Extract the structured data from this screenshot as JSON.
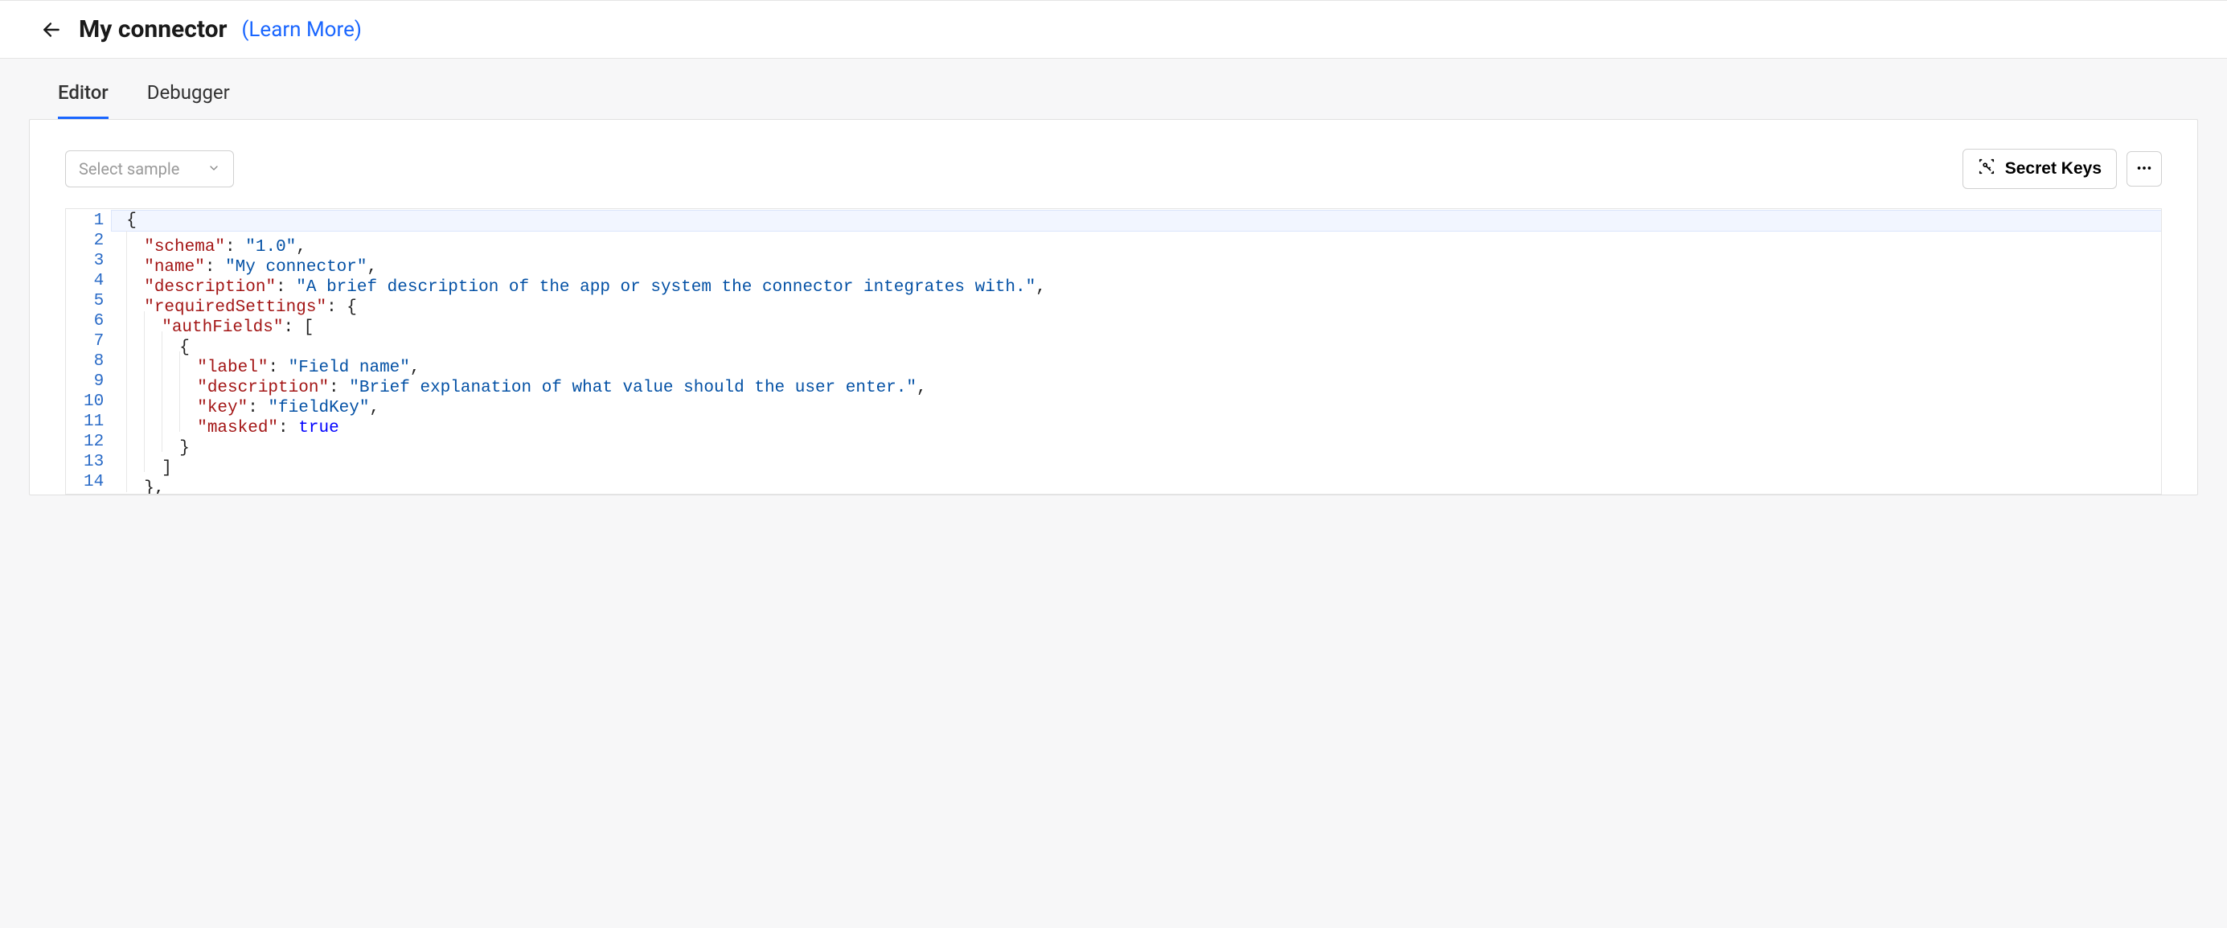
{
  "header": {
    "title": "My connector",
    "learn_more": "(Learn More)"
  },
  "tabs": {
    "editor": "Editor",
    "debugger": "Debugger",
    "active": "editor"
  },
  "toolbar": {
    "select_sample_placeholder": "Select sample",
    "secret_keys_label": "Secret Keys"
  },
  "code": {
    "line_numbers": [
      "1",
      "2",
      "3",
      "4",
      "5",
      "6",
      "7",
      "8",
      "9",
      "10",
      "11",
      "12",
      "13",
      "14"
    ],
    "active_line": 1,
    "tokens": [
      [
        {
          "t": "brace",
          "v": "{"
        }
      ],
      [
        {
          "t": "indent",
          "n": 1
        },
        {
          "t": "key",
          "v": "\"schema\""
        },
        {
          "t": "colon",
          "v": ": "
        },
        {
          "t": "str",
          "v": "\"1.0\""
        },
        {
          "t": "punc",
          "v": ","
        }
      ],
      [
        {
          "t": "indent",
          "n": 1
        },
        {
          "t": "key",
          "v": "\"name\""
        },
        {
          "t": "colon",
          "v": ": "
        },
        {
          "t": "str",
          "v": "\"My connector\""
        },
        {
          "t": "punc",
          "v": ","
        }
      ],
      [
        {
          "t": "indent",
          "n": 1
        },
        {
          "t": "key",
          "v": "\"description\""
        },
        {
          "t": "colon",
          "v": ": "
        },
        {
          "t": "str",
          "v": "\"A brief description of the app or system the connector integrates with.\""
        },
        {
          "t": "punc",
          "v": ","
        }
      ],
      [
        {
          "t": "indent",
          "n": 1
        },
        {
          "t": "key",
          "v": "\"requiredSettings\""
        },
        {
          "t": "colon",
          "v": ": "
        },
        {
          "t": "brace",
          "v": "{"
        }
      ],
      [
        {
          "t": "indent",
          "n": 2
        },
        {
          "t": "key",
          "v": "\"authFields\""
        },
        {
          "t": "colon",
          "v": ": "
        },
        {
          "t": "brace",
          "v": "["
        }
      ],
      [
        {
          "t": "indent",
          "n": 3
        },
        {
          "t": "brace",
          "v": "{"
        }
      ],
      [
        {
          "t": "indent",
          "n": 4
        },
        {
          "t": "key",
          "v": "\"label\""
        },
        {
          "t": "colon",
          "v": ": "
        },
        {
          "t": "str",
          "v": "\"Field name\""
        },
        {
          "t": "punc",
          "v": ","
        }
      ],
      [
        {
          "t": "indent",
          "n": 4
        },
        {
          "t": "key",
          "v": "\"description\""
        },
        {
          "t": "colon",
          "v": ": "
        },
        {
          "t": "str",
          "v": "\"Brief explanation of what value should the user enter.\""
        },
        {
          "t": "punc",
          "v": ","
        }
      ],
      [
        {
          "t": "indent",
          "n": 4
        },
        {
          "t": "key",
          "v": "\"key\""
        },
        {
          "t": "colon",
          "v": ": "
        },
        {
          "t": "str",
          "v": "\"fieldKey\""
        },
        {
          "t": "punc",
          "v": ","
        }
      ],
      [
        {
          "t": "indent",
          "n": 4
        },
        {
          "t": "key",
          "v": "\"masked\""
        },
        {
          "t": "colon",
          "v": ": "
        },
        {
          "t": "bool",
          "v": "true"
        }
      ],
      [
        {
          "t": "indent",
          "n": 3
        },
        {
          "t": "brace",
          "v": "}"
        }
      ],
      [
        {
          "t": "indent",
          "n": 2
        },
        {
          "t": "brace",
          "v": "]"
        }
      ],
      [
        {
          "t": "indent",
          "n": 1
        },
        {
          "t": "brace",
          "v": "}"
        },
        {
          "t": "punc",
          "v": ","
        }
      ]
    ]
  }
}
